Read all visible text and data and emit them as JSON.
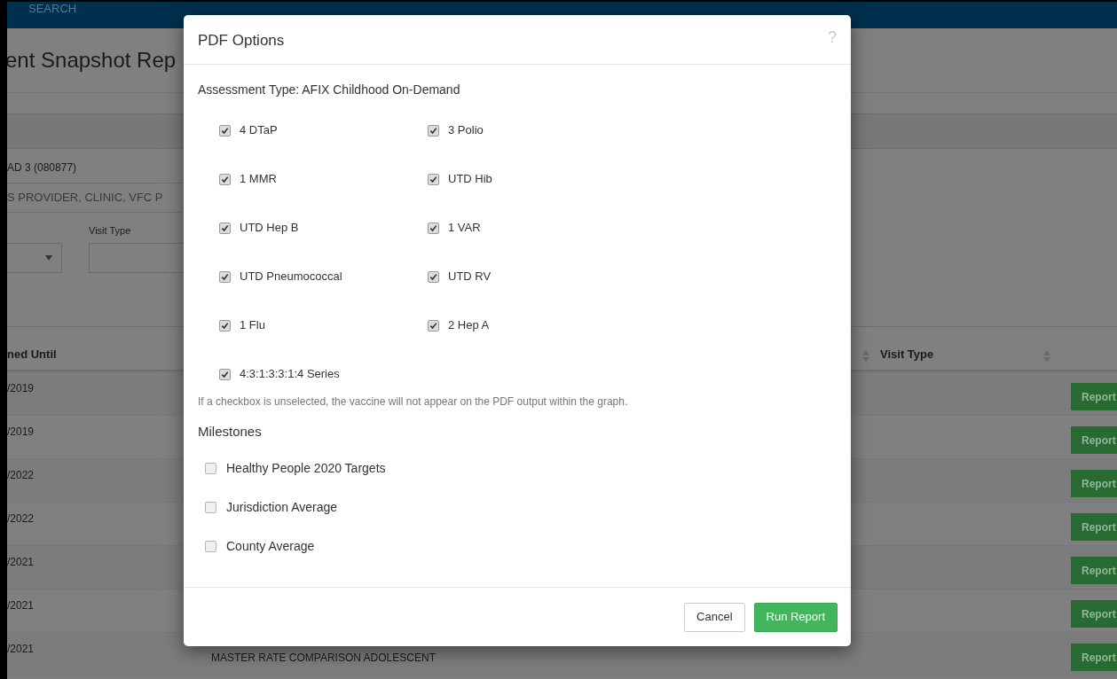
{
  "page": {
    "header": {
      "text": "SEARCH"
    },
    "title": "ent Snapshot Rep",
    "provider": {
      "code": "AD 3 (080877)",
      "field_value": "S PROVIDER, CLINIC, VFC P"
    },
    "visit_type": {
      "label": "Visit Type"
    },
    "table": {
      "columns": [
        "ned Until",
        "Visit Type"
      ],
      "rows": [
        {
          "column_1": "/2019",
          "action": "Report"
        },
        {
          "column_1": "/2019",
          "action": "Report"
        },
        {
          "column_1": "/2022",
          "action": "Report"
        },
        {
          "column_1": "/2022",
          "action": "Report"
        },
        {
          "column_1": "/2021",
          "action": "Report"
        },
        {
          "column_1": "/2021",
          "action": "Report"
        },
        {
          "column_1": "/2021",
          "column_2": "MASTER RATE COMPARISON ADOLESCENT",
          "action": "Report"
        }
      ]
    }
  },
  "dialog": {
    "title": "PDF Options",
    "help": "?",
    "assessment_type": "Assessment Type: AFIX Childhood On-Demand",
    "vaccines": [
      {
        "label": "4 DTaP",
        "checked": true
      },
      {
        "label": "3 Polio",
        "checked": true
      },
      {
        "label": "1 MMR",
        "checked": true
      },
      {
        "label": "UTD Hib",
        "checked": true
      },
      {
        "label": "UTD Hep B",
        "checked": true
      },
      {
        "label": "1 VAR",
        "checked": true
      },
      {
        "label": "UTD Pneumococcal",
        "checked": true
      },
      {
        "label": "UTD RV",
        "checked": true
      },
      {
        "label": "1 Flu",
        "checked": true
      },
      {
        "label": "2 Hep A",
        "checked": true
      },
      {
        "label": "4:3:1:3:3:1:4 Series",
        "checked": true
      }
    ],
    "note": "If a checkbox is unselected, the vaccine will not appear on the PDF output within the graph.",
    "milestones": {
      "title": "Milestones",
      "items": [
        {
          "label": "Healthy People 2020 Targets",
          "checked": false
        },
        {
          "label": "Jurisdiction Average",
          "checked": false
        },
        {
          "label": "County Average",
          "checked": false
        }
      ]
    },
    "buttons": [
      {
        "label": "Cancel",
        "kind": "secondary"
      },
      {
        "label": "Run Report",
        "kind": "primary"
      }
    ]
  }
}
